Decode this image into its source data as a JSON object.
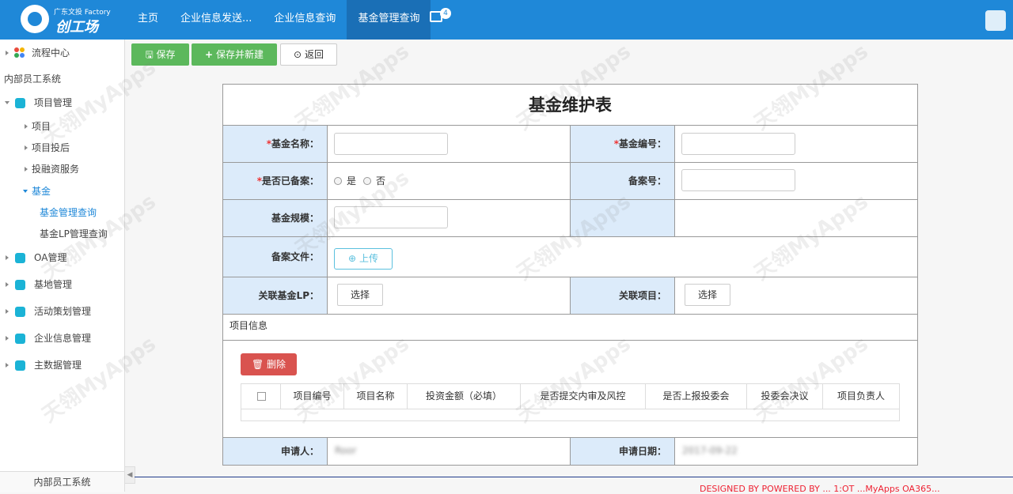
{
  "header": {
    "logo_small": "广东文投 Factory",
    "logo_big": "创工场",
    "nav": [
      "主页",
      "企业信息发送...",
      "企业信息查询",
      "基金管理查询"
    ],
    "active_nav": "基金管理查询",
    "message_count": "4"
  },
  "sidebar": {
    "flow_center": "流程中心",
    "system_title": "内部员工系统",
    "project_mgmt": "项目管理",
    "sub_project": "项目",
    "sub_post_invest": "项目投后",
    "sub_invest_service": "投融资服务",
    "sub_fund": "基金",
    "sub_fund_query": "基金管理查询",
    "sub_fund_lp_query": "基金LP管理查询",
    "oa_mgmt": "OA管理",
    "base_mgmt": "基地管理",
    "activity_mgmt": "活动策划管理",
    "enterprise_mgmt": "企业信息管理",
    "master_data_mgmt": "主数据管理",
    "footer": "内部员工系统"
  },
  "toolbar": {
    "save": "保存",
    "save_new": "保存并新建",
    "back": "返回"
  },
  "form": {
    "title": "基金维护表",
    "fund_name_label": "基金名称：",
    "fund_no_label": "基金编号：",
    "filed_label": "是否已备案：",
    "radio_yes": "是",
    "radio_no": "否",
    "filing_no_label": "备案号：",
    "fund_scale_label": "基金规模：",
    "filing_file_label": "备案文件：",
    "upload_button": "上传",
    "linked_lp_label": "关联基金LP：",
    "linked_project_label": "关联项目：",
    "choose_button": "选择",
    "project_info": "项目信息",
    "delete_button": "删除",
    "table_headers": [
      "项目编号",
      "项目名称",
      "投资金额（必填）",
      "是否提交内审及风控",
      "是否上报投委会",
      "投委会决议",
      "项目负责人"
    ],
    "applicant_label": "申请人：",
    "applicant_value": "Roor",
    "apply_date_label": "申请日期：",
    "apply_date_value": "2017-09-22"
  },
  "footer": {
    "text": "DESIGNED BY POWERED BY ... 1:OT ...MyApps OA365..."
  },
  "watermark": "天翎MyApps"
}
